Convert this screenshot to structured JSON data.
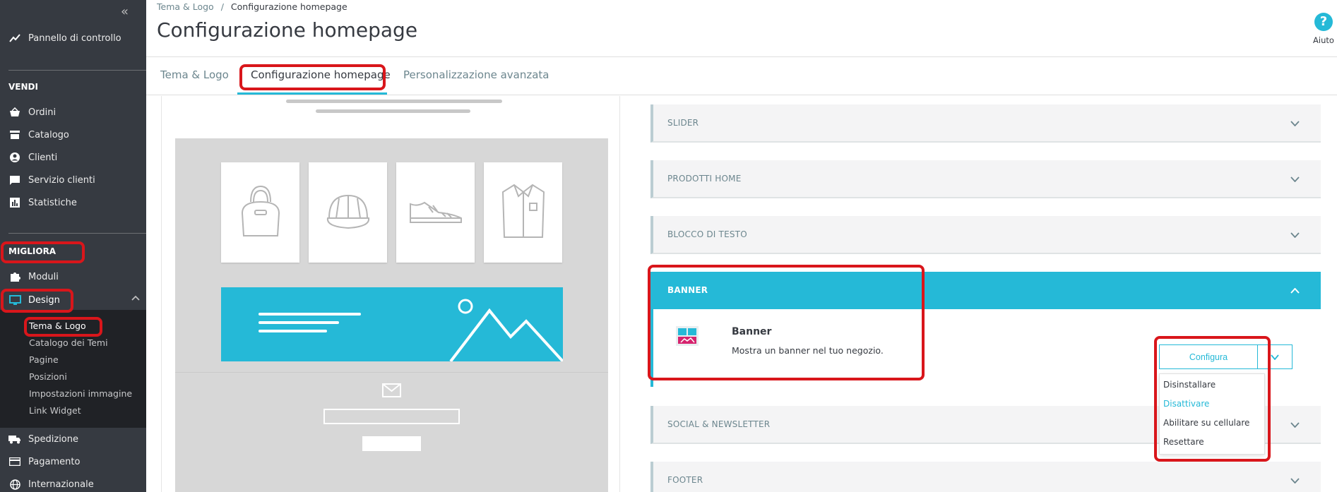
{
  "sidebar": {
    "collapse_icon": "«",
    "dashboard": "Pannello di controllo",
    "sections": {
      "sell": "VENDI",
      "improve": "MIGLIORA"
    },
    "sell_items": [
      "Ordini",
      "Catalogo",
      "Clienti",
      "Servizio clienti",
      "Statistiche"
    ],
    "improve_items": [
      "Moduli",
      "Design"
    ],
    "design_sub": [
      "Tema & Logo",
      "Catalogo dei Temi",
      "Pagine",
      "Posizioni",
      "Impostazioni immagine",
      "Link Widget"
    ],
    "bottom_items": [
      "Spedizione",
      "Pagamento",
      "Internazionale"
    ]
  },
  "header": {
    "breadcrumb_parent": "Tema & Logo",
    "breadcrumb_sep": "/",
    "breadcrumb_current": "Configurazione homepage",
    "title": "Configurazione homepage",
    "help_label": "Aiuto",
    "help_icon": "?"
  },
  "tabs": [
    "Tema & Logo",
    "Configurazione homepage",
    "Personalizzazione avanzata"
  ],
  "panels": {
    "slider": "SLIDER",
    "home_products": "PRODOTTI HOME",
    "text_block": "BLOCCO DI TESTO",
    "banner": "BANNER",
    "social": "SOCIAL & NEWSLETTER",
    "footer": "FOOTER"
  },
  "module": {
    "name": "Banner",
    "description": "Mostra un banner nel tuo negozio.",
    "configure_label": "Configura",
    "dropdown": [
      "Disinstallare",
      "Disattivare",
      "Abilitare su cellulare",
      "Resettare"
    ]
  },
  "colors": {
    "accent": "#25b9d7",
    "sidebar": "#363a41",
    "annotation": "#d9161b"
  }
}
